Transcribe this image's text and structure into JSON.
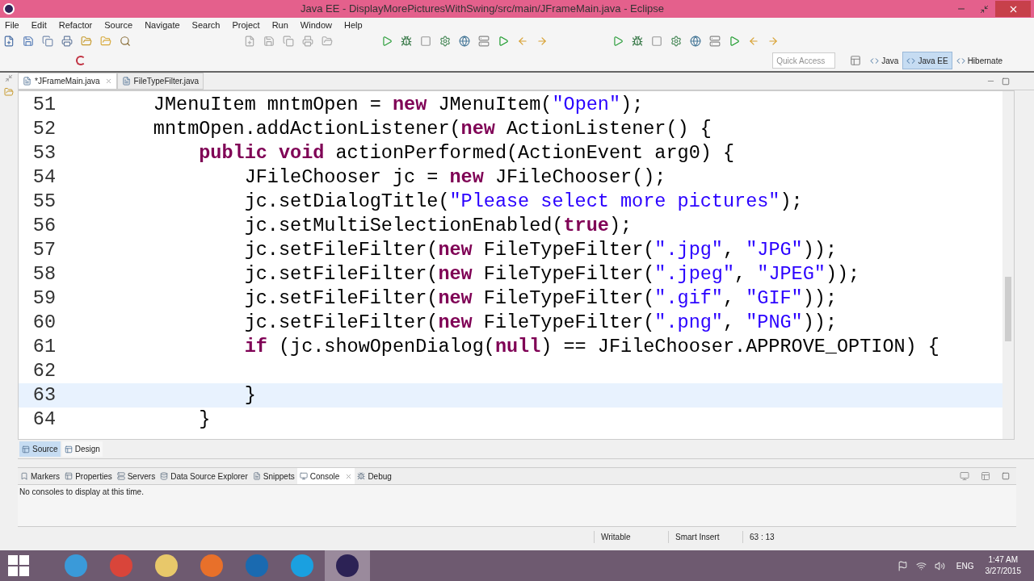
{
  "window": {
    "title": "Java EE - DisplayMorePicturesWithSwing/src/main/JFrameMain.java - Eclipse"
  },
  "menu": [
    "File",
    "Edit",
    "Refactor",
    "Source",
    "Navigate",
    "Search",
    "Project",
    "Run",
    "Window",
    "Help"
  ],
  "quick_access": {
    "placeholder": "Quick Access"
  },
  "perspectives": [
    {
      "label": "Java",
      "selected": false
    },
    {
      "label": "Java EE",
      "selected": true
    },
    {
      "label": "Hibernate",
      "selected": false
    }
  ],
  "editor_tabs": [
    {
      "label": "*JFrameMain.java",
      "selected": true,
      "closable": true
    },
    {
      "label": "FileTypeFilter.java",
      "selected": false,
      "closable": false
    }
  ],
  "code": [
    {
      "number": "51",
      "current": false,
      "segments": [
        {
          "kind": "plain",
          "text": "        JMenuItem mntmOpen = "
        },
        {
          "kind": "keyword",
          "text": "new"
        },
        {
          "kind": "plain",
          "text": " JMenuItem("
        },
        {
          "kind": "string",
          "text": "\"Open\""
        },
        {
          "kind": "plain",
          "text": ");"
        }
      ]
    },
    {
      "number": "52",
      "current": false,
      "segments": [
        {
          "kind": "plain",
          "text": "        mntmOpen.addActionListener("
        },
        {
          "kind": "keyword",
          "text": "new"
        },
        {
          "kind": "plain",
          "text": " ActionListener() {"
        }
      ]
    },
    {
      "number": "53",
      "current": false,
      "segments": [
        {
          "kind": "keyword",
          "text": "            public void"
        },
        {
          "kind": "plain",
          "text": " actionPerformed(ActionEvent arg0) {"
        }
      ]
    },
    {
      "number": "54",
      "current": false,
      "segments": [
        {
          "kind": "plain",
          "text": "                JFileChooser jc = "
        },
        {
          "kind": "keyword",
          "text": "new"
        },
        {
          "kind": "plain",
          "text": " JFileChooser();"
        }
      ]
    },
    {
      "number": "55",
      "current": false,
      "segments": [
        {
          "kind": "plain",
          "text": "                jc.setDialogTitle("
        },
        {
          "kind": "string",
          "text": "\"Please select more pictures\""
        },
        {
          "kind": "plain",
          "text": ");"
        }
      ]
    },
    {
      "number": "56",
      "current": false,
      "segments": [
        {
          "kind": "plain",
          "text": "                jc.setMultiSelectionEnabled("
        },
        {
          "kind": "keyword",
          "text": "true"
        },
        {
          "kind": "plain",
          "text": ");"
        }
      ]
    },
    {
      "number": "57",
      "current": false,
      "segments": [
        {
          "kind": "plain",
          "text": "                jc.setFileFilter("
        },
        {
          "kind": "keyword",
          "text": "new"
        },
        {
          "kind": "plain",
          "text": " FileTypeFilter("
        },
        {
          "kind": "string",
          "text": "\".jpg\""
        },
        {
          "kind": "plain",
          "text": ", "
        },
        {
          "kind": "string",
          "text": "\"JPG\""
        },
        {
          "kind": "plain",
          "text": "));"
        }
      ]
    },
    {
      "number": "58",
      "current": false,
      "segments": [
        {
          "kind": "plain",
          "text": "                jc.setFileFilter("
        },
        {
          "kind": "keyword",
          "text": "new"
        },
        {
          "kind": "plain",
          "text": " FileTypeFilter("
        },
        {
          "kind": "string",
          "text": "\".jpeg\""
        },
        {
          "kind": "plain",
          "text": ", "
        },
        {
          "kind": "string",
          "text": "\"JPEG\""
        },
        {
          "kind": "plain",
          "text": "));"
        }
      ]
    },
    {
      "number": "59",
      "current": false,
      "segments": [
        {
          "kind": "plain",
          "text": "                jc.setFileFilter("
        },
        {
          "kind": "keyword",
          "text": "new"
        },
        {
          "kind": "plain",
          "text": " FileTypeFilter("
        },
        {
          "kind": "string",
          "text": "\".gif\""
        },
        {
          "kind": "plain",
          "text": ", "
        },
        {
          "kind": "string",
          "text": "\"GIF\""
        },
        {
          "kind": "plain",
          "text": "));"
        }
      ]
    },
    {
      "number": "60",
      "current": false,
      "segments": [
        {
          "kind": "plain",
          "text": "                jc.setFileFilter("
        },
        {
          "kind": "keyword",
          "text": "new"
        },
        {
          "kind": "plain",
          "text": " FileTypeFilter("
        },
        {
          "kind": "string",
          "text": "\".png\""
        },
        {
          "kind": "plain",
          "text": ", "
        },
        {
          "kind": "string",
          "text": "\"PNG\""
        },
        {
          "kind": "plain",
          "text": "));"
        }
      ]
    },
    {
      "number": "61",
      "current": false,
      "segments": [
        {
          "kind": "keyword",
          "text": "                if"
        },
        {
          "kind": "plain",
          "text": " (jc.showOpenDialog("
        },
        {
          "kind": "keyword",
          "text": "null"
        },
        {
          "kind": "plain",
          "text": ") == JFileChooser.APPROVE_OPTION) {"
        }
      ]
    },
    {
      "number": "62",
      "current": false
    },
    {
      "number": "63",
      "current": true,
      "segments": [
        {
          "kind": "plain",
          "text": "                }"
        }
      ]
    },
    {
      "number": "64",
      "current": false,
      "segments": [
        {
          "kind": "plain",
          "text": "            }"
        }
      ]
    }
  ],
  "editor_mode_tabs": [
    {
      "label": "Source",
      "selected": true
    },
    {
      "label": "Design",
      "selected": false
    }
  ],
  "view_tabs": [
    {
      "label": "Markers",
      "selected": false
    },
    {
      "label": "Properties",
      "selected": false
    },
    {
      "label": "Servers",
      "selected": false
    },
    {
      "label": "Data Source Explorer",
      "selected": false
    },
    {
      "label": "Snippets",
      "selected": false
    },
    {
      "label": "Console",
      "selected": true
    },
    {
      "label": "Debug",
      "selected": false
    }
  ],
  "console": {
    "message": "No consoles to display at this time."
  },
  "status_bar": [
    "Writable",
    "Smart Insert",
    "63 : 13"
  ],
  "taskbar": {
    "language": "ENG",
    "time": "1:47 AM",
    "date": "3/27/2015"
  }
}
